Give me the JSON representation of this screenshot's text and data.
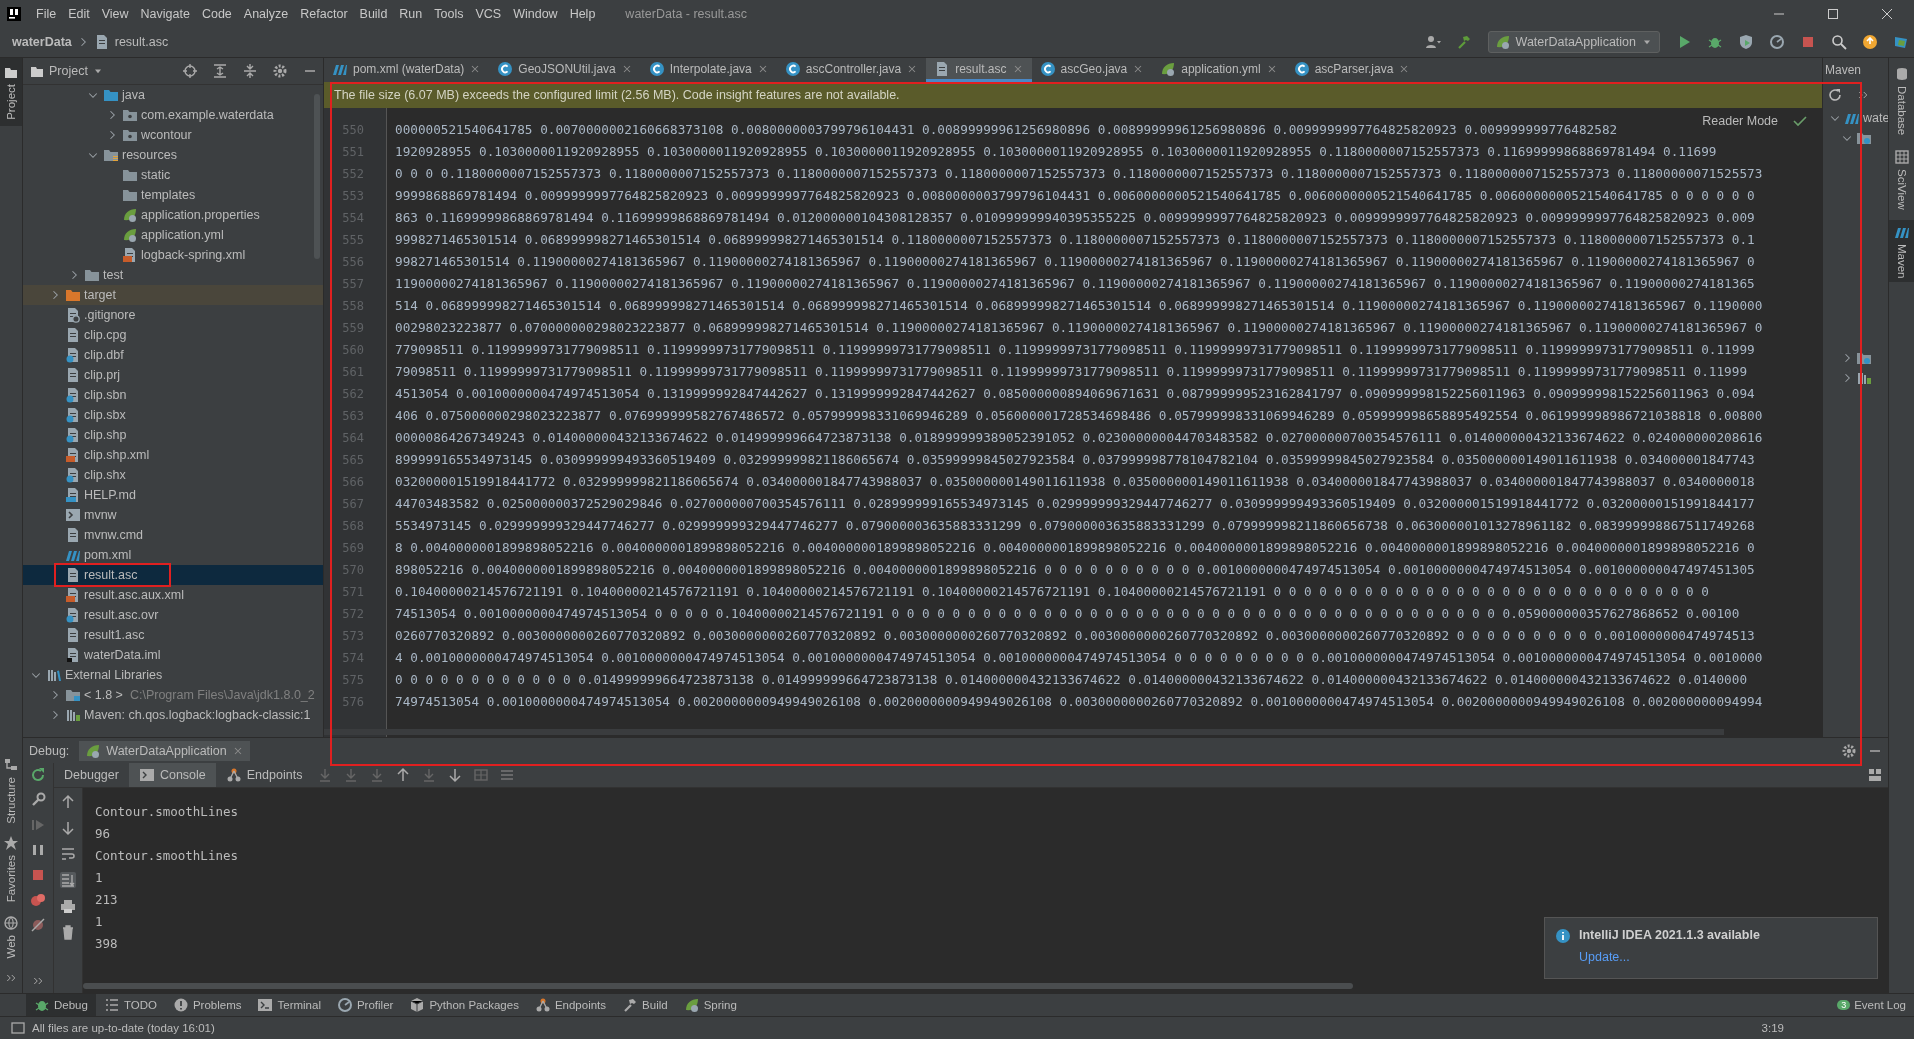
{
  "window": {
    "menu": [
      "File",
      "Edit",
      "View",
      "Navigate",
      "Code",
      "Analyze",
      "Refactor",
      "Build",
      "Run",
      "Tools",
      "VCS",
      "Window",
      "Help"
    ],
    "title": "waterData - result.asc"
  },
  "breadcrumb": [
    "waterData",
    "result.asc"
  ],
  "toolbar": {
    "run_configuration": "WaterDataApplication"
  },
  "left_strip": [
    {
      "label": "Project",
      "kind": "project",
      "selected": true
    },
    {
      "label": "Structure",
      "kind": "structure",
      "selected": false
    },
    {
      "label": "Favorites",
      "kind": "favorites",
      "selected": false
    },
    {
      "label": "Web",
      "kind": "web",
      "selected": false
    }
  ],
  "project_panel": {
    "title": "Project",
    "tree": [
      {
        "children": [
          {
            "children": [
              {
                "children": [
                  {
                    "label": "java",
                    "kind": "source-folder",
                    "expanded": true,
                    "selected": false,
                    "children": [
                      {
                        "label": "com.example.waterdata",
                        "kind": "package",
                        "expanded": false,
                        "selected": false
                      },
                      {
                        "label": "wcontour",
                        "kind": "package",
                        "expanded": false,
                        "selected": false
                      }
                    ]
                  },
                  {
                    "label": "resources",
                    "kind": "resources-folder",
                    "expanded": true,
                    "selected": false,
                    "children": [
                      {
                        "label": "static",
                        "kind": "folder",
                        "selected": false
                      },
                      {
                        "label": "templates",
                        "kind": "folder",
                        "selected": false
                      },
                      {
                        "label": "application.properties",
                        "kind": "spring",
                        "selected": false
                      },
                      {
                        "label": "application.yml",
                        "kind": "spring",
                        "selected": false
                      },
                      {
                        "label": "logback-spring.xml",
                        "kind": "xml",
                        "selected": false
                      }
                    ]
                  }
                ]
              },
              {
                "label": "test",
                "kind": "folder",
                "expanded": false,
                "selected": false
              }
            ]
          },
          {
            "label": "target",
            "kind": "excluded-folder",
            "expanded": false,
            "selected": false
          },
          {
            "label": ".gitignore",
            "kind": "ignore",
            "selected": false
          },
          {
            "label": "clip.cpg",
            "kind": "file",
            "selected": false
          },
          {
            "label": "clip.dbf",
            "kind": "unknown",
            "selected": false
          },
          {
            "label": "clip.prj",
            "kind": "file",
            "selected": false
          },
          {
            "label": "clip.sbn",
            "kind": "unknown",
            "selected": false
          },
          {
            "label": "clip.sbx",
            "kind": "unknown",
            "selected": false
          },
          {
            "label": "clip.shp",
            "kind": "unknown",
            "selected": false
          },
          {
            "label": "clip.shp.xml",
            "kind": "xml",
            "selected": false
          },
          {
            "label": "clip.shx",
            "kind": "unknown",
            "selected": false
          },
          {
            "label": "HELP.md",
            "kind": "markdown",
            "selected": false
          },
          {
            "label": "mvnw",
            "kind": "script",
            "selected": false
          },
          {
            "label": "mvnw.cmd",
            "kind": "file",
            "selected": false
          },
          {
            "label": "pom.xml",
            "kind": "maven",
            "selected": false
          },
          {
            "label": "result.asc",
            "kind": "file",
            "selected": true
          },
          {
            "label": "result.asc.aux.xml",
            "kind": "xml",
            "selected": false
          },
          {
            "label": "result.asc.ovr",
            "kind": "unknown",
            "selected": false
          },
          {
            "label": "result1.asc",
            "kind": "file",
            "selected": false
          },
          {
            "label": "waterData.iml",
            "kind": "module",
            "selected": false
          }
        ]
      },
      {
        "label": "External Libraries",
        "kind": "libraries",
        "expanded": true,
        "selected": false,
        "children": [
          {
            "label": "< 1.8 >",
            "detail": "C:\\Program Files\\Java\\jdk1.8.0_2",
            "kind": "jdk",
            "expanded": false,
            "selected": false
          },
          {
            "label": "Maven: ch.qos.logback:logback-classic:1",
            "kind": "library",
            "expanded": false,
            "selected": false
          }
        ]
      }
    ]
  },
  "editor_tabs": [
    {
      "label": "pom.xml (waterData)",
      "kind": "maven",
      "selected": false
    },
    {
      "label": "GeoJSONUtil.java",
      "kind": "class",
      "selected": false
    },
    {
      "label": "Interpolate.java",
      "kind": "class",
      "selected": false
    },
    {
      "label": "ascController.java",
      "kind": "class",
      "selected": false
    },
    {
      "label": "result.asc",
      "kind": "file",
      "selected": true
    },
    {
      "label": "ascGeo.java",
      "kind": "class",
      "selected": false
    },
    {
      "label": "application.yml",
      "kind": "spring",
      "selected": false
    },
    {
      "label": "ascParser.java",
      "kind": "class",
      "selected": false
    }
  ],
  "banner": "The file size (6.07 MB) exceeds the configured limit (2.56 MB). Code insight features are not available.",
  "reader_mode": "Reader Mode",
  "editor": {
    "lines": [
      {
        "number": "550",
        "text": "000000521540641785 0.0070000002160668373108 0.0080000003799796104431 0.00899999961256980896 0.00899999961256980896 0.0099999997764825820923 0.009999999776482582"
      },
      {
        "number": "551",
        "text": "1920928955 0.1030000011920928955 0.1030000011920928955 0.1030000011920928955 0.1030000011920928955 0.1030000011920928955 0.1180000007152557373 0.11699999868869781494 0.11699"
      },
      {
        "number": "552",
        "text": "0 0 0 0.1180000007152557373 0.1180000007152557373 0.1180000007152557373 0.1180000007152557373 0.1180000007152557373 0.1180000007152557373 0.1180000007152557373 0.11800000071525573"
      },
      {
        "number": "553",
        "text": "9999868869781494 0.0099999997764825820923 0.0099999997764825820923 0.0080000003799796104431 0.0060000000521540641785 0.0060000000521540641785 0.0060000000521540641785 0 0 0 0 0 0"
      },
      {
        "number": "554",
        "text": "863 0.11699999868869781494 0.11699999868869781494 0.012000000104308128357 0.010999999940395355225 0.0099999997764825820923 0.0099999997764825820923 0.0099999997764825820923 0.009"
      },
      {
        "number": "555",
        "text": "9998271465301514 0.068999998271465301514 0.068999998271465301514 0.1180000007152557373 0.1180000007152557373 0.1180000007152557373 0.1180000007152557373 0.1180000007152557373 0.1"
      },
      {
        "number": "556",
        "text": "998271465301514 0.11900000274181365967 0.11900000274181365967 0.11900000274181365967 0.11900000274181365967 0.11900000274181365967 0.11900000274181365967 0.11900000274181365967 0"
      },
      {
        "number": "557",
        "text": "11900000274181365967 0.11900000274181365967 0.11900000274181365967 0.11900000274181365967 0.11900000274181365967 0.11900000274181365967 0.11900000274181365967 0.11900000274181365"
      },
      {
        "number": "558",
        "text": "514 0.068999998271465301514 0.068999998271465301514 0.068999998271465301514 0.068999998271465301514 0.068999998271465301514 0.11900000274181365967 0.11900000274181365967 0.1190000"
      },
      {
        "number": "559",
        "text": "00298023223877 0.070000000298023223877 0.068999998271465301514 0.11900000274181365967 0.11900000274181365967 0.11900000274181365967 0.11900000274181365967 0.11900000274181365967 0"
      },
      {
        "number": "560",
        "text": "779098511 0.11999999731779098511 0.11999999731779098511 0.11999999731779098511 0.11999999731779098511 0.11999999731779098511 0.11999999731779098511 0.11999999731779098511 0.11999"
      },
      {
        "number": "561",
        "text": "79098511 0.11999999731779098511 0.11999999731779098511 0.11999999731779098511 0.11999999731779098511 0.11999999731779098511 0.11999999731779098511 0.11999999731779098511 0.11999"
      },
      {
        "number": "562",
        "text": "4513054 0.0010000000474974513054 0.1319999992847442627 0.1319999992847442627 0.085000000894069671631 0.087999999523162841797 0.090999998152256011963 0.090999998152256011963 0.094"
      },
      {
        "number": "563",
        "text": "406 0.075000000298023223877 0.076999999582767486572 0.057999998331069946289 0.056000001728534698486 0.057999998331069946289 0.059999998658895492554 0.061999998986721038818 0.00800"
      },
      {
        "number": "564",
        "text": "00000864267349243 0.014000000432133674622 0.014999999664723873138 0.018999999389052391052 0.023000000044703483582 0.027000000700354576111 0.014000000432133674622 0.024000000208616"
      },
      {
        "number": "565",
        "text": "899999165534973145 0.030999999493360519409 0.032999999821186065674 0.03599999845027923584 0.037999998778104782104 0.03599999845027923584 0.035000000149011611938 0.034000001847743"
      },
      {
        "number": "566",
        "text": "032000001519918441772 0.032999999821186065674 0.034000001847743988037 0.035000000149011611938 0.035000000149011611938 0.034000001847743988037 0.034000001847743988037 0.0340000018"
      },
      {
        "number": "567",
        "text": "44703483582 0.025000000372529029846 0.027000000700354576111 0.028999999165534973145 0.029999999329447746277 0.030999999493360519409 0.032000001519918441772 0.03200000151991844177"
      },
      {
        "number": "568",
        "text": "5534973145 0.029999999329447746277 0.029999999329447746277 0.079000003635883331299 0.079000003635883331299 0.079999998211860656738 0.063000001013278961182 0.083999998867511749268"
      },
      {
        "number": "569",
        "text": "8 0.0040000001899898052216 0.0040000001899898052216 0.0040000001899898052216 0.0040000001899898052216 0.0040000001899898052216 0.0040000001899898052216 0.0040000001899898052216 0"
      },
      {
        "number": "570",
        "text": "898052216 0.0040000001899898052216 0.0040000001899898052216 0.0040000001899898052216 0 0 0 0 0 0 0 0 0 0 0.0010000000474974513054 0.0010000000474974513054 0.001000000047497451305"
      },
      {
        "number": "571",
        "text": "0.10400000214576721191 0.10400000214576721191 0.10400000214576721191 0.10400000214576721191 0.10400000214576721191 0 0 0 0 0 0 0 0 0 0 0 0 0 0 0 0 0 0 0 0 0 0 0 0 0 0 0 0 0"
      },
      {
        "number": "572",
        "text": "74513054 0.0010000000474974513054 0 0 0 0 0.10400000214576721191 0 0 0 0 0 0 0 0 0 0 0 0 0 0 0 0 0 0 0 0 0 0 0 0 0 0 0 0 0 0 0 0 0 0 0 0 0 0 0 0 0.059000000357627868652 0.00100"
      },
      {
        "number": "573",
        "text": "0260770320892 0.0030000000260770320892 0.0030000000260770320892 0.0030000000260770320892 0.0030000000260770320892 0.0030000000260770320892 0 0 0 0 0 0 0 0 0 0.0010000000474974513"
      },
      {
        "number": "574",
        "text": "4 0.0010000000474974513054 0.0010000000474974513054 0.0010000000474974513054 0.0010000000474974513054 0 0 0 0 0 0 0 0 0 0.0010000000474974513054 0.0010000000474974513054 0.0010000"
      },
      {
        "number": "575",
        "text": "0 0 0 0 0 0 0 0 0 0 0 0 0.014999999664723873138 0.014999999664723873138 0.014000000432133674622 0.014000000432133674622 0.014000000432133674622 0.014000000432133674622 0.0140000"
      },
      {
        "number": "576",
        "text": "74974513054 0.0010000000474974513054 0.0020000000949949026108 0.0020000000949949026108 0.0030000000260770320892 0.0010000000474974513054 0.0020000000949949026108 0.002000000094994"
      }
    ]
  },
  "maven_panel": {
    "title": "Maven",
    "items": [
      {
        "label": "wate",
        "kind": "maven",
        "expanded": true
      },
      {
        "kind": "lifecycle",
        "expanded": true
      },
      {
        "kind": "plugins",
        "expanded": false
      },
      {
        "kind": "library",
        "expanded": false
      }
    ]
  },
  "right_strip": [
    {
      "label": "Database",
      "kind": "database",
      "selected": false
    },
    {
      "label": "SciView",
      "kind": "sciview",
      "selected": false
    },
    {
      "label": "Maven",
      "kind": "maven",
      "selected": true
    }
  ],
  "debug": {
    "label": "Debug:",
    "session": "WaterDataApplication",
    "tabs": [
      {
        "label": "Debugger",
        "kind": "debugger",
        "selected": false
      },
      {
        "label": "Console",
        "kind": "console",
        "selected": true
      },
      {
        "label": "Endpoints",
        "kind": "endpoints",
        "selected": false
      }
    ],
    "console": [
      "Contour.smoothLines",
      "96",
      "Contour.smoothLines",
      "1",
      "213",
      "1",
      "398"
    ]
  },
  "notification": {
    "title": "IntelliJ IDEA 2021.1.3 available",
    "link": "Update..."
  },
  "tool_tabs": [
    {
      "label": "Debug",
      "kind": "debug",
      "selected": true
    },
    {
      "label": "TODO",
      "kind": "todo",
      "selected": false
    },
    {
      "label": "Problems",
      "kind": "problems",
      "selected": false
    },
    {
      "label": "Terminal",
      "kind": "terminal",
      "selected": false
    },
    {
      "label": "Profiler",
      "kind": "profiler",
      "selected": false
    },
    {
      "label": "Python Packages",
      "kind": "packages",
      "selected": false
    },
    {
      "label": "Endpoints",
      "kind": "endpoints",
      "selected": false
    },
    {
      "label": "Build",
      "kind": "build",
      "selected": false
    },
    {
      "label": "Spring",
      "kind": "spring",
      "selected": false
    }
  ],
  "event_log": {
    "label": "Event Log",
    "count": "3"
  },
  "status_bar": {
    "message": "All files are up-to-date (today 16:01)",
    "position": "3:19"
  }
}
